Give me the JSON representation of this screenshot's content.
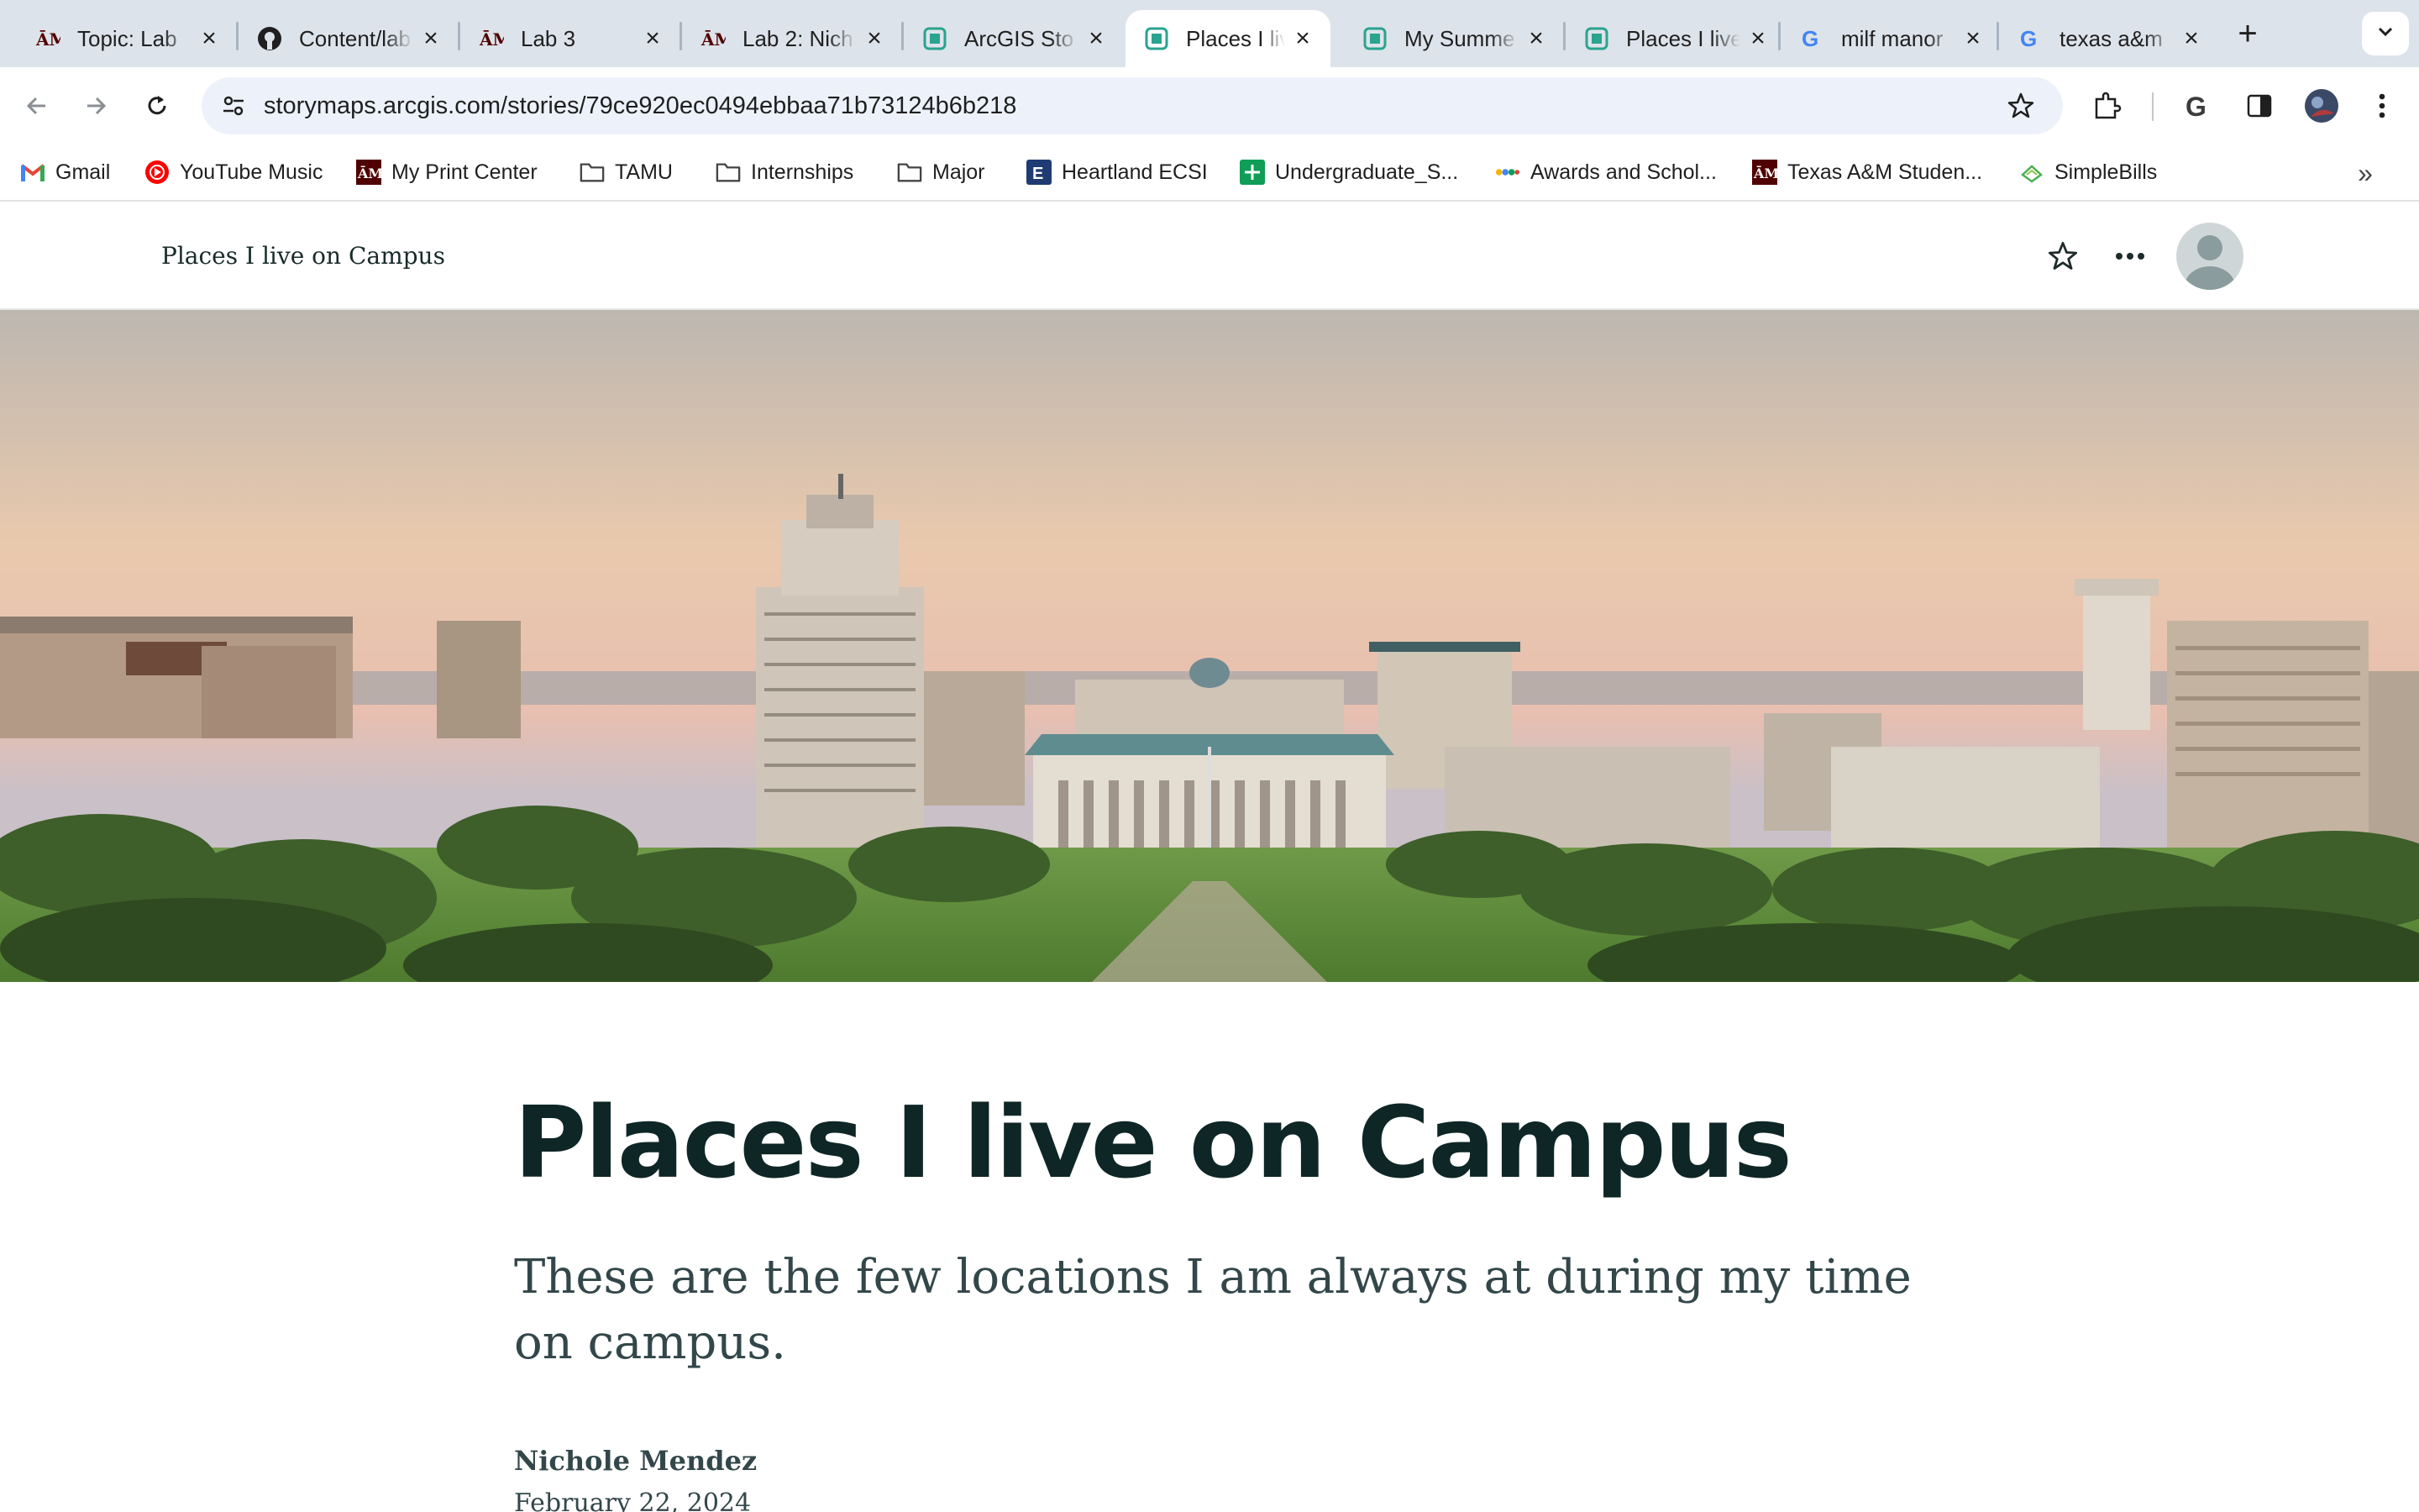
{
  "browser": {
    "tabs": [
      {
        "title": "Topic: Lab",
        "icon": "tamu-icon",
        "active": false
      },
      {
        "title": "Content/lab",
        "icon": "github-icon",
        "active": false
      },
      {
        "title": "Lab 3",
        "icon": "tamu-icon",
        "active": false
      },
      {
        "title": "Lab 2: Nich",
        "icon": "tamu-icon",
        "active": false
      },
      {
        "title": "ArcGIS Sto",
        "icon": "storymaps-icon",
        "active": false
      },
      {
        "title": "Places I live",
        "icon": "storymaps-icon",
        "active": true
      },
      {
        "title": "My Summe",
        "icon": "storymaps-icon",
        "active": false
      },
      {
        "title": "Places I live",
        "icon": "storymaps-icon",
        "active": false
      },
      {
        "title": "milf manor",
        "icon": "google-icon",
        "active": false
      },
      {
        "title": "texas a&m",
        "icon": "google-icon",
        "active": false
      }
    ],
    "new_tab_symbol": "+",
    "url": "storymaps.arcgis.com/stories/79ce920ec0494ebbaa71b73124b6b218",
    "bookmarks": [
      {
        "label": "Gmail",
        "icon": "gmail-icon"
      },
      {
        "label": "YouTube Music",
        "icon": "youtube-music-icon"
      },
      {
        "label": "My Print Center",
        "icon": "tamu-icon"
      },
      {
        "label": "TAMU",
        "icon": "folder-icon"
      },
      {
        "label": "Internships",
        "icon": "folder-icon"
      },
      {
        "label": "Major",
        "icon": "folder-icon"
      },
      {
        "label": "Heartland ECSI",
        "icon": "heartland-icon"
      },
      {
        "label": "Undergraduate_S...",
        "icon": "sheets-icon"
      },
      {
        "label": "Awards and Schol...",
        "icon": "awards-icon"
      },
      {
        "label": "Texas A&M Studen...",
        "icon": "tamu-icon"
      },
      {
        "label": "SimpleBills",
        "icon": "simplebills-icon"
      }
    ],
    "bookmarks_overflow": "»"
  },
  "story": {
    "header_title": "Places I live on Campus",
    "title": "Places I live on Campus",
    "subtitle": "These are the few locations I am always at during my time on campus.",
    "author": "Nichole Mendez",
    "date": "February 22, 2024"
  },
  "colors": {
    "tabstrip": "#dde3ea",
    "omnibox": "#edf2fa",
    "title": "#0f2626",
    "body_text": "#33474a",
    "tamu_maroon": "#500000",
    "storymaps_teal": "#2aa38f"
  }
}
